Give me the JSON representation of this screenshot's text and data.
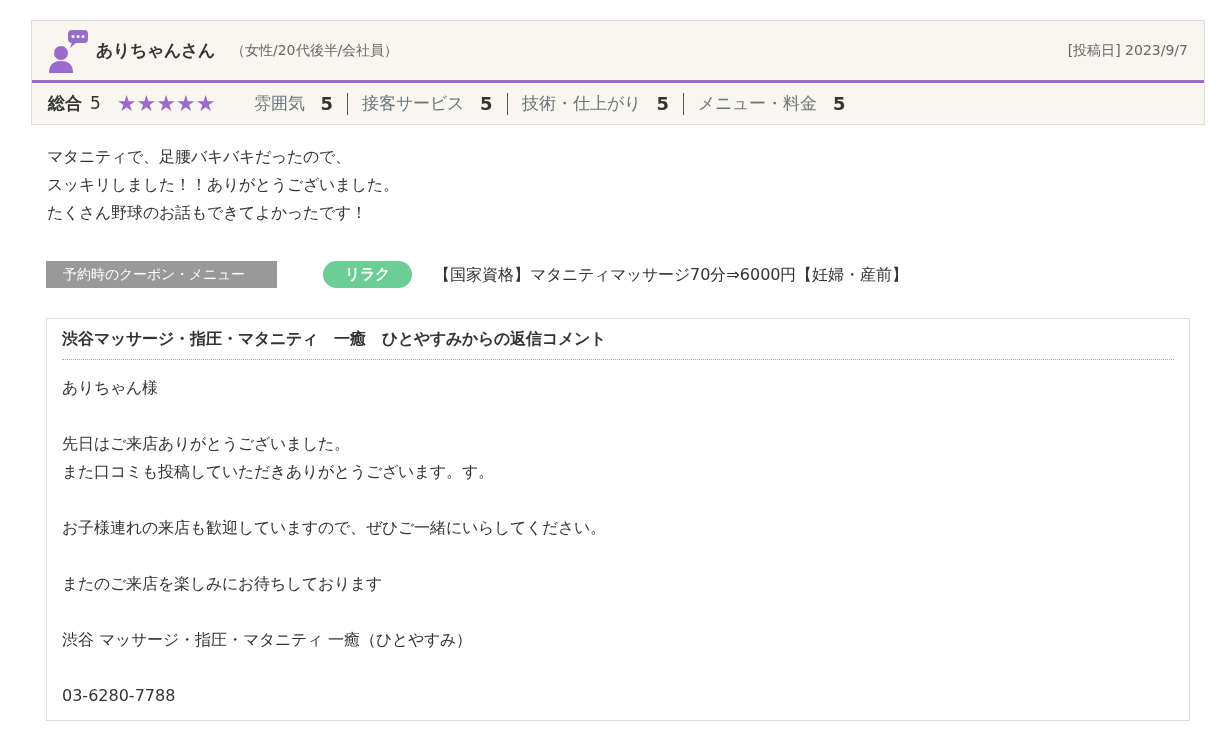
{
  "review": {
    "reviewer_name": "ありちゃんさん",
    "reviewer_profile": "（女性/20代後半/会社員）",
    "posted_date": "[投稿日] 2023/9/7",
    "overall_label": "総合",
    "overall_score": "5",
    "stars": 5,
    "ratings": [
      {
        "label": "雰囲気",
        "value": "5"
      },
      {
        "label": "接客サービス",
        "value": "5"
      },
      {
        "label": "技術・仕上がり",
        "value": "5"
      },
      {
        "label": "メニュー・料金",
        "value": "5"
      }
    ],
    "comment": [
      "マタニティで、足腰バキバキだったので、",
      "スッキリしました！！ありがとうございました。",
      "たくさん野球のお話もできてよかったです！"
    ]
  },
  "coupon": {
    "label": "予約時のクーポン・メニュー",
    "tag": "リラク",
    "name": "【国家資格】マタニティマッサージ70分⇒6000円【妊婦・産前】"
  },
  "reply": {
    "title": "渋谷マッサージ・指圧・マタニティ　一癒　ひとやすみからの返信コメント",
    "paragraphs": [
      [
        "ありちゃん様"
      ],
      [
        "先日はご来店ありがとうございました。",
        "また口コミも投稿していただきありがとうございます。す。"
      ],
      [
        "お子様連れの来店も歓迎していますので、ぜひご一緒にいらしてください。"
      ],
      [
        "またのご来店を楽しみにお待ちしております"
      ],
      [
        "渋谷 マッサージ・指圧・マタニティ 一癒（ひとやすみ）"
      ],
      [
        "03-6280-7788"
      ]
    ]
  }
}
